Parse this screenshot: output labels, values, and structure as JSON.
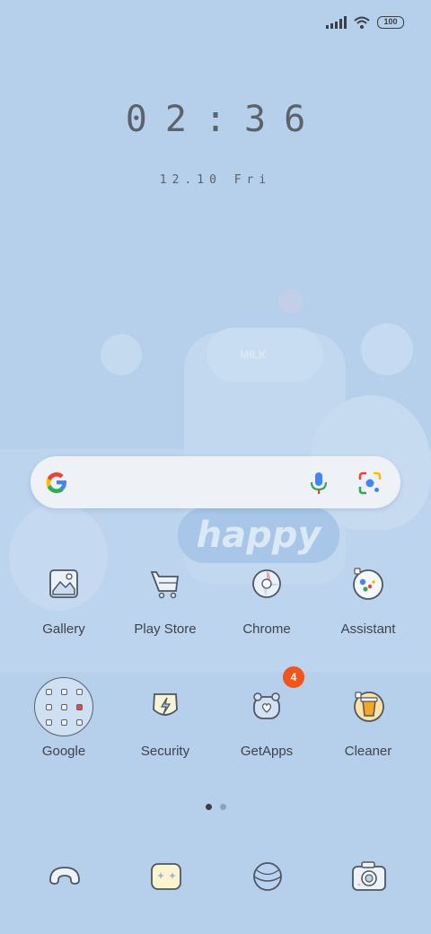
{
  "status_bar": {
    "battery_level": "100",
    "icons": [
      "signal-icon",
      "wifi-icon",
      "battery-icon"
    ]
  },
  "clock": {
    "time": "02:36",
    "date": "12.10 Fri"
  },
  "wallpaper": {
    "label_text": "happy",
    "bottle_text": "MILK"
  },
  "search_bar": {
    "icons": [
      "google-g-icon",
      "microphone-icon",
      "lens-camera-icon"
    ]
  },
  "apps_row1": [
    {
      "label": "Gallery",
      "icon": "gallery-icon"
    },
    {
      "label": "Play Store",
      "icon": "play-store-icon"
    },
    {
      "label": "Chrome",
      "icon": "chrome-icon"
    },
    {
      "label": "Assistant",
      "icon": "assistant-icon"
    }
  ],
  "apps_row2": [
    {
      "label": "Google",
      "icon": "folder-icon"
    },
    {
      "label": "Security",
      "icon": "security-icon"
    },
    {
      "label": "GetApps",
      "icon": "getapps-icon",
      "badge": "4"
    },
    {
      "label": "Cleaner",
      "icon": "cleaner-icon"
    }
  ],
  "pager": {
    "pages": 2,
    "active": 0
  },
  "dock": [
    {
      "icon": "phone-icon"
    },
    {
      "icon": "messages-icon"
    },
    {
      "icon": "browser-icon"
    },
    {
      "icon": "camera-icon"
    }
  ],
  "colors": {
    "background": "#b6cfea",
    "badge": "#f2541b",
    "text": "#3e434b"
  }
}
